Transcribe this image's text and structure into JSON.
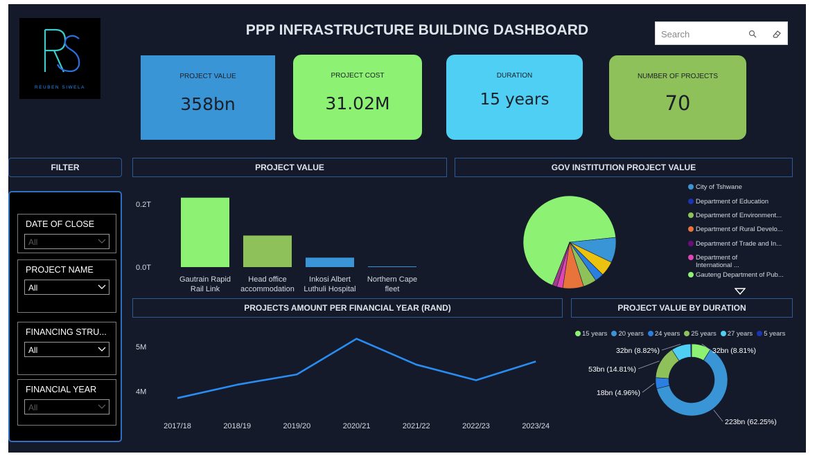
{
  "logo": {
    "initials": "RS",
    "name": "REUBEN SIWELA"
  },
  "header": {
    "title": "PPP INFRASTRUCTURE BUILDING DASHBOARD"
  },
  "search": {
    "placeholder": "Search"
  },
  "kpis": [
    {
      "label": "PROJECT VALUE",
      "value": "358bn",
      "color": "#3a95d6"
    },
    {
      "label": "PROJECT COST",
      "value": "31.02M",
      "color": "#8df173"
    },
    {
      "label": "DURATION",
      "value": "15 years",
      "color": "#4fcff3"
    },
    {
      "label": "NUMBER OF PROJECTS",
      "value": "70",
      "color": "#8ec15a"
    }
  ],
  "filters": {
    "title": "FILTER",
    "items": [
      {
        "label": "DATE OF CLOSE",
        "value": "All",
        "enabled": false
      },
      {
        "label": "PROJECT NAME",
        "value": "All",
        "enabled": true
      },
      {
        "label": "FINANCING STRU...",
        "value": "All",
        "enabled": true
      },
      {
        "label": "FINANCIAL YEAR",
        "value": "All",
        "enabled": false
      }
    ]
  },
  "sections": {
    "project_value": "PROJECT  VALUE",
    "gov_value": "GOV INSTITUTION PROJECT VALUE",
    "per_year": "PROJECTS AMOUNT  PER FINANCIAL YEAR (RAND)",
    "by_duration": "PROJECT VALUE BY DURATION"
  },
  "chart_data": [
    {
      "type": "bar",
      "categories": [
        "Gautrain Rapid Rail Link",
        "Head office accommodation",
        "Inkosi Albert Luthuli Hospital",
        "Northern Cape fleet"
      ],
      "category_lines": [
        [
          "Gautrain Rapid",
          "Rail Link"
        ],
        [
          "Head office",
          "accommodation"
        ],
        [
          "Inkosi Albert",
          "Luthuli Hospital"
        ],
        [
          "Northern Cape",
          "fleet"
        ]
      ],
      "values": [
        0.22,
        0.1,
        0.03,
        0.002
      ],
      "colors": [
        "#8df173",
        "#8ec15a",
        "#3a95d6",
        "#3a95d6"
      ],
      "yticks": [
        "0.2T",
        "0.0T"
      ],
      "ylim": [
        0,
        0.25
      ]
    },
    {
      "type": "pie",
      "legend": [
        "City of Tshwane",
        "Department of Education",
        "Department of Environment...",
        "Department of Rural Develo...",
        "Department of Trade and In...",
        "Department of International ...",
        "Gauteng Department of Pub..."
      ],
      "legend_lines": [
        [
          "City of Tshwane"
        ],
        [
          "Department of Education"
        ],
        [
          "Department of Environment..."
        ],
        [
          "Department of Rural Develo..."
        ],
        [
          "Department of Trade and In..."
        ],
        [
          "Department of",
          "International ..."
        ],
        [
          "Gauteng Department of Pub..."
        ]
      ],
      "legend_colors": [
        "#3a95d6",
        "#1a34b3",
        "#8ec15a",
        "#e8733b",
        "#6a0f7a",
        "#e045b5",
        "#8df173"
      ],
      "slices": [
        {
          "value": 65.0,
          "color": "#8df173"
        },
        {
          "value": 8.5,
          "color": "#3a95d6"
        },
        {
          "value": 5.0,
          "color": "#ebc20f"
        },
        {
          "value": 3.0,
          "color": "#2a7fe0"
        },
        {
          "value": 4.5,
          "color": "#8ec15a"
        },
        {
          "value": 7.0,
          "color": "#e8733b"
        },
        {
          "value": 2.0,
          "color": "#e045b5"
        },
        {
          "value": 1.5,
          "color": "#a13c8a"
        }
      ]
    },
    {
      "type": "line",
      "x": [
        "2017/18",
        "2018/19",
        "2019/20",
        "2020/21",
        "2021/22",
        "2022/23",
        "2023/24"
      ],
      "values": [
        3.85,
        4.15,
        4.38,
        5.18,
        4.6,
        4.25,
        4.67
      ],
      "yticks": [
        {
          "label": "5M",
          "value": 5.0
        },
        {
          "label": "4M",
          "value": 4.0
        }
      ],
      "ylim": [
        3.7,
        5.25
      ],
      "color": "#2a8cf0"
    },
    {
      "type": "pie",
      "legend": [
        "15 years",
        "20 years",
        "24 years",
        "25 years",
        "27 years",
        "5 years"
      ],
      "legend_colors": [
        "#8df173",
        "#3a95d6",
        "#2a7fe0",
        "#8ec15a",
        "#4fcff3",
        "#1a34b3"
      ],
      "slices": [
        {
          "value": 8.81,
          "color": "#8df173",
          "label": "32bn (8.81%)"
        },
        {
          "value": 62.25,
          "color": "#3a95d6",
          "label": "223bn (62.25%)"
        },
        {
          "value": 4.96,
          "color": "#2a7fe0",
          "label": "18bn (4.96%)"
        },
        {
          "value": 14.81,
          "color": "#8ec15a",
          "label": "53bn (14.81%)"
        },
        {
          "value": 8.82,
          "color": "#4fcff3",
          "label": "32bn (8.82%)"
        },
        {
          "value": 0.35,
          "color": "#1a34b3"
        }
      ]
    }
  ]
}
